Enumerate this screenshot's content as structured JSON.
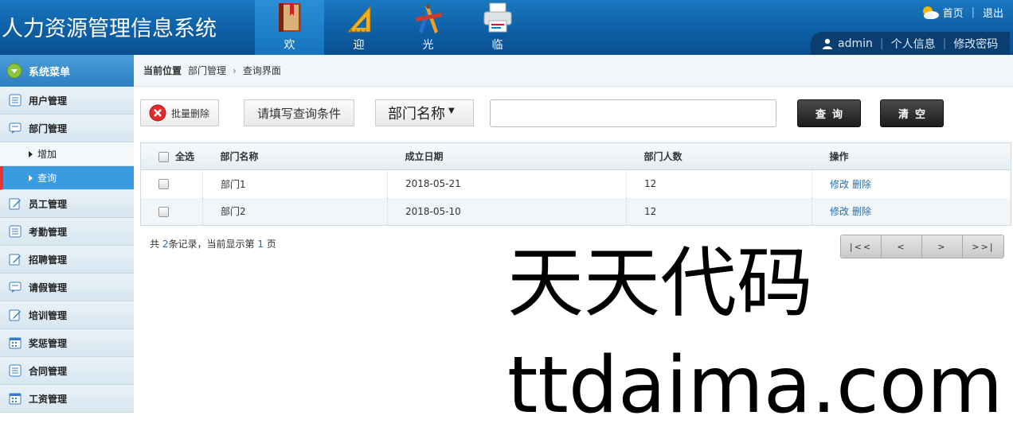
{
  "header": {
    "title": "人力资源管理信息系统",
    "nav": [
      {
        "label": "欢",
        "icon": "book-icon"
      },
      {
        "label": "迎",
        "icon": "ruler-icon"
      },
      {
        "label": "光",
        "icon": "pencil-tools-icon"
      },
      {
        "label": "临",
        "icon": "printer-icon"
      }
    ],
    "links": {
      "home": "首页",
      "logout": "退出"
    },
    "user": {
      "name": "admin",
      "profile": "个人信息",
      "change_password": "修改密码"
    }
  },
  "sidebar": {
    "title": "系统菜单",
    "items": [
      {
        "label": "用户管理"
      },
      {
        "label": "部门管理"
      },
      {
        "label": "员工管理"
      },
      {
        "label": "考勤管理"
      },
      {
        "label": "招聘管理"
      },
      {
        "label": "请假管理"
      },
      {
        "label": "培训管理"
      },
      {
        "label": "奖惩管理"
      },
      {
        "label": "合同管理"
      },
      {
        "label": "工资管理"
      }
    ],
    "sub_items": [
      {
        "label": "增加"
      },
      {
        "label": "查询"
      }
    ]
  },
  "breadcrumb": {
    "label": "当前位置",
    "parent": "部门管理",
    "arrow": "›",
    "current": "查询界面"
  },
  "toolbar": {
    "batch_delete": "批量删除",
    "condition_hint": "请填写查询条件",
    "field_select": "部门名称",
    "field_arrow": "▼",
    "search_value": "",
    "query": "查询",
    "clear": "清空"
  },
  "table": {
    "headers": {
      "select_all": "全选",
      "name": "部门名称",
      "date": "成立日期",
      "count": "部门人数",
      "ops": "操作"
    },
    "rows": [
      {
        "name": "部门1",
        "date": "2018-05-21",
        "count": "12",
        "edit": "修改",
        "delete": "删除"
      },
      {
        "name": "部门2",
        "date": "2018-05-10",
        "count": "12",
        "edit": "修改",
        "delete": "删除"
      }
    ]
  },
  "pager": {
    "prefix": "共",
    "total": "2",
    "mid": "条记录，当前显示第",
    "page": "1",
    "suffix": "页",
    "first": "|<<",
    "prev": "<",
    "next": ">",
    "last": ">>|"
  },
  "watermark": {
    "cn": "天天代码",
    "en": "ttdaima.com"
  }
}
